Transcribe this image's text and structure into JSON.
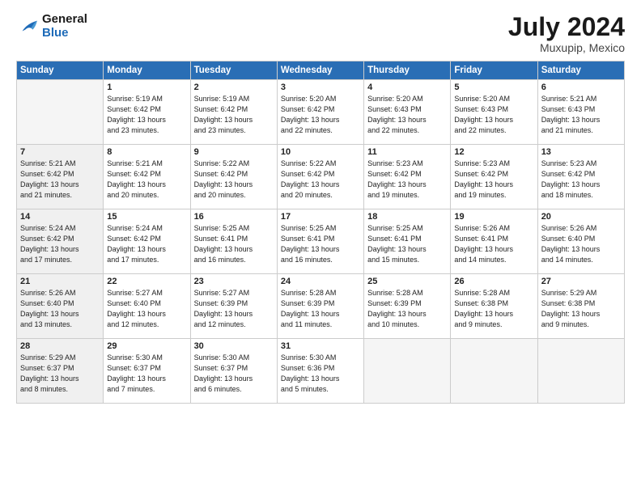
{
  "header": {
    "logo_line1": "General",
    "logo_line2": "Blue",
    "month": "July 2024",
    "location": "Muxupip, Mexico"
  },
  "days_of_week": [
    "Sunday",
    "Monday",
    "Tuesday",
    "Wednesday",
    "Thursday",
    "Friday",
    "Saturday"
  ],
  "weeks": [
    [
      {
        "day": "",
        "info": ""
      },
      {
        "day": "1",
        "info": "Sunrise: 5:19 AM\nSunset: 6:42 PM\nDaylight: 13 hours\nand 23 minutes."
      },
      {
        "day": "2",
        "info": "Sunrise: 5:19 AM\nSunset: 6:42 PM\nDaylight: 13 hours\nand 23 minutes."
      },
      {
        "day": "3",
        "info": "Sunrise: 5:20 AM\nSunset: 6:42 PM\nDaylight: 13 hours\nand 22 minutes."
      },
      {
        "day": "4",
        "info": "Sunrise: 5:20 AM\nSunset: 6:43 PM\nDaylight: 13 hours\nand 22 minutes."
      },
      {
        "day": "5",
        "info": "Sunrise: 5:20 AM\nSunset: 6:43 PM\nDaylight: 13 hours\nand 22 minutes."
      },
      {
        "day": "6",
        "info": "Sunrise: 5:21 AM\nSunset: 6:43 PM\nDaylight: 13 hours\nand 21 minutes."
      }
    ],
    [
      {
        "day": "7",
        "info": ""
      },
      {
        "day": "8",
        "info": "Sunrise: 5:21 AM\nSunset: 6:42 PM\nDaylight: 13 hours\nand 20 minutes."
      },
      {
        "day": "9",
        "info": "Sunrise: 5:22 AM\nSunset: 6:42 PM\nDaylight: 13 hours\nand 20 minutes."
      },
      {
        "day": "10",
        "info": "Sunrise: 5:22 AM\nSunset: 6:42 PM\nDaylight: 13 hours\nand 20 minutes."
      },
      {
        "day": "11",
        "info": "Sunrise: 5:23 AM\nSunset: 6:42 PM\nDaylight: 13 hours\nand 19 minutes."
      },
      {
        "day": "12",
        "info": "Sunrise: 5:23 AM\nSunset: 6:42 PM\nDaylight: 13 hours\nand 19 minutes."
      },
      {
        "day": "13",
        "info": "Sunrise: 5:23 AM\nSunset: 6:42 PM\nDaylight: 13 hours\nand 18 minutes."
      }
    ],
    [
      {
        "day": "14",
        "info": ""
      },
      {
        "day": "15",
        "info": "Sunrise: 5:24 AM\nSunset: 6:42 PM\nDaylight: 13 hours\nand 17 minutes."
      },
      {
        "day": "16",
        "info": "Sunrise: 5:25 AM\nSunset: 6:41 PM\nDaylight: 13 hours\nand 16 minutes."
      },
      {
        "day": "17",
        "info": "Sunrise: 5:25 AM\nSunset: 6:41 PM\nDaylight: 13 hours\nand 16 minutes."
      },
      {
        "day": "18",
        "info": "Sunrise: 5:25 AM\nSunset: 6:41 PM\nDaylight: 13 hours\nand 15 minutes."
      },
      {
        "day": "19",
        "info": "Sunrise: 5:26 AM\nSunset: 6:41 PM\nDaylight: 13 hours\nand 14 minutes."
      },
      {
        "day": "20",
        "info": "Sunrise: 5:26 AM\nSunset: 6:40 PM\nDaylight: 13 hours\nand 14 minutes."
      }
    ],
    [
      {
        "day": "21",
        "info": ""
      },
      {
        "day": "22",
        "info": "Sunrise: 5:27 AM\nSunset: 6:40 PM\nDaylight: 13 hours\nand 12 minutes."
      },
      {
        "day": "23",
        "info": "Sunrise: 5:27 AM\nSunset: 6:39 PM\nDaylight: 13 hours\nand 12 minutes."
      },
      {
        "day": "24",
        "info": "Sunrise: 5:28 AM\nSunset: 6:39 PM\nDaylight: 13 hours\nand 11 minutes."
      },
      {
        "day": "25",
        "info": "Sunrise: 5:28 AM\nSunset: 6:39 PM\nDaylight: 13 hours\nand 10 minutes."
      },
      {
        "day": "26",
        "info": "Sunrise: 5:28 AM\nSunset: 6:38 PM\nDaylight: 13 hours\nand 9 minutes."
      },
      {
        "day": "27",
        "info": "Sunrise: 5:29 AM\nSunset: 6:38 PM\nDaylight: 13 hours\nand 9 minutes."
      }
    ],
    [
      {
        "day": "28",
        "info": "Sunrise: 5:29 AM\nSunset: 6:37 PM\nDaylight: 13 hours\nand 8 minutes."
      },
      {
        "day": "29",
        "info": "Sunrise: 5:30 AM\nSunset: 6:37 PM\nDaylight: 13 hours\nand 7 minutes."
      },
      {
        "day": "30",
        "info": "Sunrise: 5:30 AM\nSunset: 6:37 PM\nDaylight: 13 hours\nand 6 minutes."
      },
      {
        "day": "31",
        "info": "Sunrise: 5:30 AM\nSunset: 6:36 PM\nDaylight: 13 hours\nand 5 minutes."
      },
      {
        "day": "",
        "info": ""
      },
      {
        "day": "",
        "info": ""
      },
      {
        "day": "",
        "info": ""
      }
    ]
  ],
  "week1_sun_info": "Sunrise: 5:21 AM\nSunset: 6:42 PM\nDaylight: 13 hours\nand 21 minutes.",
  "week3_sun_info": "Sunrise: 5:24 AM\nSunset: 6:42 PM\nDaylight: 13 hours\nand 17 minutes.",
  "week4_sun_info": "Sunrise: 5:26 AM\nSunset: 6:40 PM\nDaylight: 13 hours\nand 13 minutes."
}
